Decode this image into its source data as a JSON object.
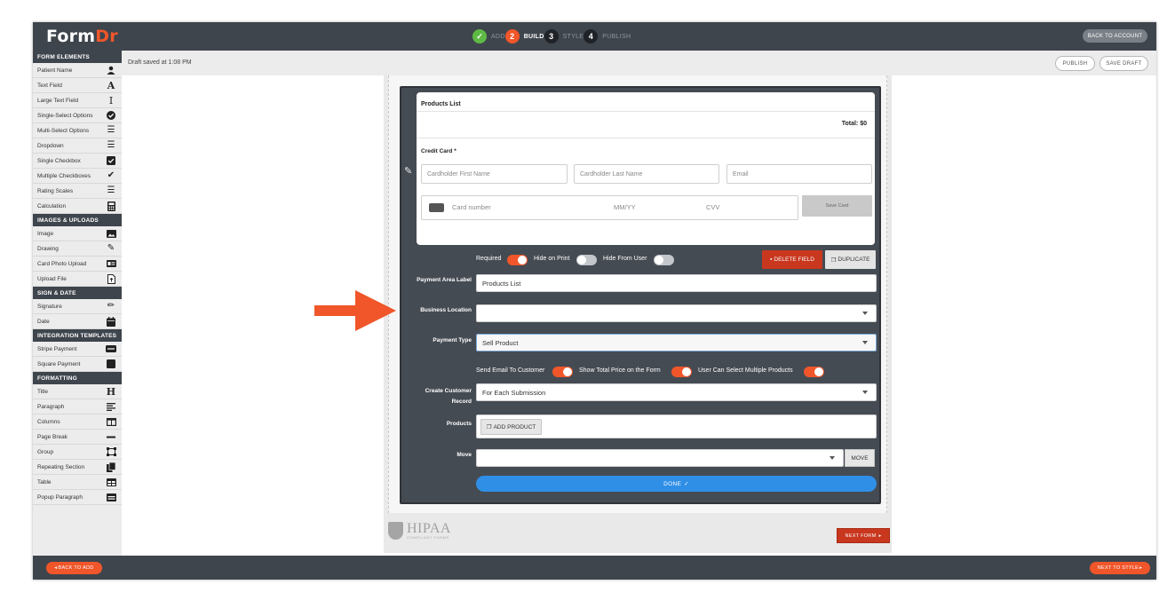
{
  "app": {
    "logo_main": "Form",
    "logo_accent": "Dr",
    "back_to_account": "BACK TO ACCOUNT"
  },
  "steps": [
    {
      "num": "",
      "label": "ADD",
      "state": "done"
    },
    {
      "num": "2",
      "label": "BUILD",
      "state": "active"
    },
    {
      "num": "3",
      "label": "STYLE",
      "state": "todo"
    },
    {
      "num": "4",
      "label": "PUBLISH",
      "state": "todo"
    }
  ],
  "subbar": {
    "draft_status": "Draft saved at 1:08 PM",
    "publish": "PUBLISH",
    "save_draft": "SAVE DRAFT"
  },
  "sidebar": {
    "sections": [
      {
        "title": "FORM ELEMENTS",
        "items": [
          {
            "label": "Patient Name",
            "icon": "person-icon"
          },
          {
            "label": "Text Field",
            "icon": "letter-a-icon"
          },
          {
            "label": "Large Text Field",
            "icon": "text-cursor-icon"
          },
          {
            "label": "Single-Select Options",
            "icon": "check-circle-icon"
          },
          {
            "label": "Multi-Select Options",
            "icon": "list-icon"
          },
          {
            "label": "Dropdown",
            "icon": "list-icon"
          },
          {
            "label": "Single Checkbox",
            "icon": "checkbox-icon"
          },
          {
            "label": "Multiple Checkboxes",
            "icon": "double-check-icon"
          },
          {
            "label": "Rating Scales",
            "icon": "rating-list-icon"
          },
          {
            "label": "Calculation",
            "icon": "calculator-icon"
          }
        ]
      },
      {
        "title": "IMAGES & UPLOADS",
        "items": [
          {
            "label": "Image",
            "icon": "image-icon"
          },
          {
            "label": "Drawing",
            "icon": "draw-icon"
          },
          {
            "label": "Card Photo Upload",
            "icon": "id-card-icon"
          },
          {
            "label": "Upload File",
            "icon": "file-icon"
          }
        ]
      },
      {
        "title": "SIGN & DATE",
        "items": [
          {
            "label": "Signature",
            "icon": "pen-icon"
          },
          {
            "label": "Date",
            "icon": "calendar-icon"
          }
        ]
      },
      {
        "title": "INTEGRATION TEMPLATES",
        "items": [
          {
            "label": "Stripe Payment",
            "icon": "stripe-icon"
          },
          {
            "label": "Square Payment",
            "icon": "square-icon"
          }
        ]
      },
      {
        "title": "FORMATTING",
        "items": [
          {
            "label": "Title",
            "icon": "heading-icon"
          },
          {
            "label": "Paragraph",
            "icon": "paragraph-icon"
          },
          {
            "label": "Columns",
            "icon": "columns-icon"
          },
          {
            "label": "Page Break",
            "icon": "page-break-icon"
          },
          {
            "label": "Group",
            "icon": "group-icon"
          },
          {
            "label": "Repeating Section",
            "icon": "copy-icon"
          },
          {
            "label": "Table",
            "icon": "table-icon"
          },
          {
            "label": "Popup Paragraph",
            "icon": "popup-icon"
          }
        ]
      }
    ]
  },
  "preview": {
    "products_list_title": "Products List",
    "total": "Total: $0",
    "credit_card_label": "Credit Card *",
    "first_name_placeholder": "Cardholder First Name",
    "last_name_placeholder": "Cardholder Last Name",
    "email_placeholder": "Email",
    "card_number": "Card number",
    "mmyy": "MM/YY",
    "cvv": "CVV",
    "save_card": "Save Card"
  },
  "settings": {
    "required": "Required",
    "hide_on_print": "Hide on Print",
    "hide_from_user": "Hide From User",
    "delete_field": "DELETE FIELD",
    "duplicate": "DUPLICATE",
    "payment_area_label": "Payment Area Label",
    "payment_area_value": "Products List",
    "business_location": "Business Location",
    "business_location_value": "",
    "payment_type": "Payment Type",
    "payment_type_value": "Sell Product",
    "send_email": "Send Email To Customer",
    "show_total": "Show Total Price on the Form",
    "multiple_products": "User Can Select Multiple Products",
    "create_customer_record_l1": "Create Customer",
    "create_customer_record_l2": "Record",
    "create_customer_value": "For Each Submission",
    "products": "Products",
    "add_product": "ADD PRODUCT",
    "move": "Move",
    "move_value": "",
    "move_btn": "MOVE",
    "done": "DONE"
  },
  "toggles": {
    "required": true,
    "hide_on_print": false,
    "hide_from_user": false,
    "send_email": true,
    "show_total": true,
    "multiple_products": true
  },
  "hipaa": {
    "title": "HIPAA",
    "subtitle": "COMPLIANT FORMS"
  },
  "next_form": "NEXT FORM",
  "footer": {
    "back_to_add": "BACK TO ADD",
    "next_to_style": "NEXT TO STYLE"
  },
  "colors": {
    "accent": "#f0562a",
    "dark": "#3f454d",
    "success": "#5fba45",
    "danger": "#c9371f",
    "primary": "#2f8fe6"
  }
}
